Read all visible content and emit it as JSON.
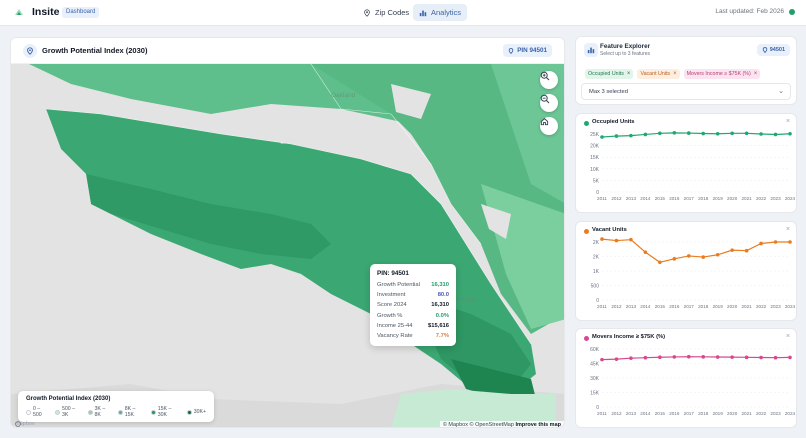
{
  "topbar": {
    "app_name": "Insite",
    "badge": "Dashboard",
    "nav": [
      {
        "label": "Zip Codes",
        "icon": "map-pin-icon",
        "active": false
      },
      {
        "label": "Analytics",
        "icon": "bar-chart-icon",
        "active": true
      }
    ],
    "updated": "Last updated: Feb 2026",
    "status_color": "#22a06b"
  },
  "map": {
    "title": "Growth Potential Index (2030)",
    "pin_chip": "PIN 94501",
    "places": [
      "Oakland",
      "Alameda"
    ],
    "controls": [
      "zoom-in-icon",
      "zoom-out-icon",
      "home-icon"
    ],
    "tooltip": {
      "title": "PIN: 94501",
      "rows": [
        {
          "k": "Growth Potential",
          "v": "16,310",
          "color": "#1f9d6b"
        },
        {
          "k": "Investment",
          "v": "80.0",
          "color": "#4a5ab8"
        },
        {
          "k": "Score 2024",
          "v": "16,310",
          "color": "#111827"
        },
        {
          "k": "Growth %",
          "v": "0.0%",
          "color": "#1f9d6b"
        },
        {
          "k": "Income 25-44",
          "v": "$15,616",
          "color": "#111827"
        },
        {
          "k": "Vacancy Rate",
          "v": "7.7%",
          "color": "#e07b39"
        }
      ]
    },
    "legend": {
      "title": "Growth Potential Index (2030)",
      "items": [
        {
          "label": "0 – 500",
          "color": "#ffffff"
        },
        {
          "label": "500 – 3K",
          "color": "#c9ecd7"
        },
        {
          "label": "3K – 8K",
          "color": "#8fd3ad"
        },
        {
          "label": "8K – 15K",
          "color": "#4fb887"
        },
        {
          "label": "15K – 30K",
          "color": "#25925f"
        },
        {
          "label": "30K+",
          "color": "#12663e"
        }
      ]
    },
    "attribution": {
      "text": "© Mapbox © OpenStreetMap",
      "improve": "Improve this map"
    },
    "mapbox_label": "mapbox"
  },
  "feature_explorer": {
    "title": "Feature Explorer",
    "subtitle": "Select up to 3 features",
    "pin_chip": "94501",
    "chips": [
      {
        "label": "Occupied Units",
        "bg": "#e3f5ea",
        "fg": "#1f7a4d"
      },
      {
        "label": "Vacant Units",
        "bg": "#fdeee0",
        "fg": "#b8621f"
      },
      {
        "label": "Movers Income ≥ $75K (%)",
        "bg": "#fbe4ef",
        "fg": "#b83c77"
      }
    ],
    "max_selected": "Max 3 selected"
  },
  "chart_data": [
    {
      "type": "line",
      "title": "Occupied Units",
      "color": "#1fa872",
      "x": [
        "2011",
        "2012",
        "2013",
        "2014",
        "2015",
        "2016",
        "2017",
        "2018",
        "2019",
        "2020",
        "2021",
        "2022",
        "2023",
        "2024"
      ],
      "y_ticks": [
        "0",
        "5K",
        "10K",
        "15K",
        "20K",
        "25K"
      ],
      "ylim": [
        0,
        25000
      ],
      "values": [
        23700,
        24100,
        24300,
        24800,
        25300,
        25500,
        25400,
        25200,
        25100,
        25300,
        25300,
        25000,
        24800,
        25100
      ],
      "grid": true
    },
    {
      "type": "line",
      "title": "Vacant Units",
      "color": "#ea7c1f",
      "x": [
        "2011",
        "2012",
        "2013",
        "2014",
        "2015",
        "2016",
        "2017",
        "2018",
        "2019",
        "2020",
        "2021",
        "2022",
        "2023",
        "2024"
      ],
      "y_ticks": [
        "0",
        "500",
        "1K",
        "2K",
        "2K"
      ],
      "ylim": [
        0,
        2000
      ],
      "values": [
        2100,
        2050,
        2080,
        1650,
        1300,
        1420,
        1520,
        1480,
        1560,
        1720,
        1700,
        1950,
        2000,
        2000
      ],
      "grid": true
    },
    {
      "type": "line",
      "title": "Movers Income ≥ $75K (%)",
      "color": "#d6498e",
      "x": [
        "2011",
        "2012",
        "2013",
        "2014",
        "2015",
        "2016",
        "2017",
        "2018",
        "2019",
        "2020",
        "2021",
        "2022",
        "2023",
        "2024"
      ],
      "y_ticks": [
        "0",
        "15K",
        "30K",
        "45K",
        "60K"
      ],
      "ylim": [
        0,
        60000
      ],
      "values": [
        49000,
        49500,
        50500,
        51000,
        51500,
        51800,
        52000,
        51900,
        51700,
        51600,
        51400,
        51200,
        51000,
        51300
      ],
      "grid": true
    }
  ]
}
